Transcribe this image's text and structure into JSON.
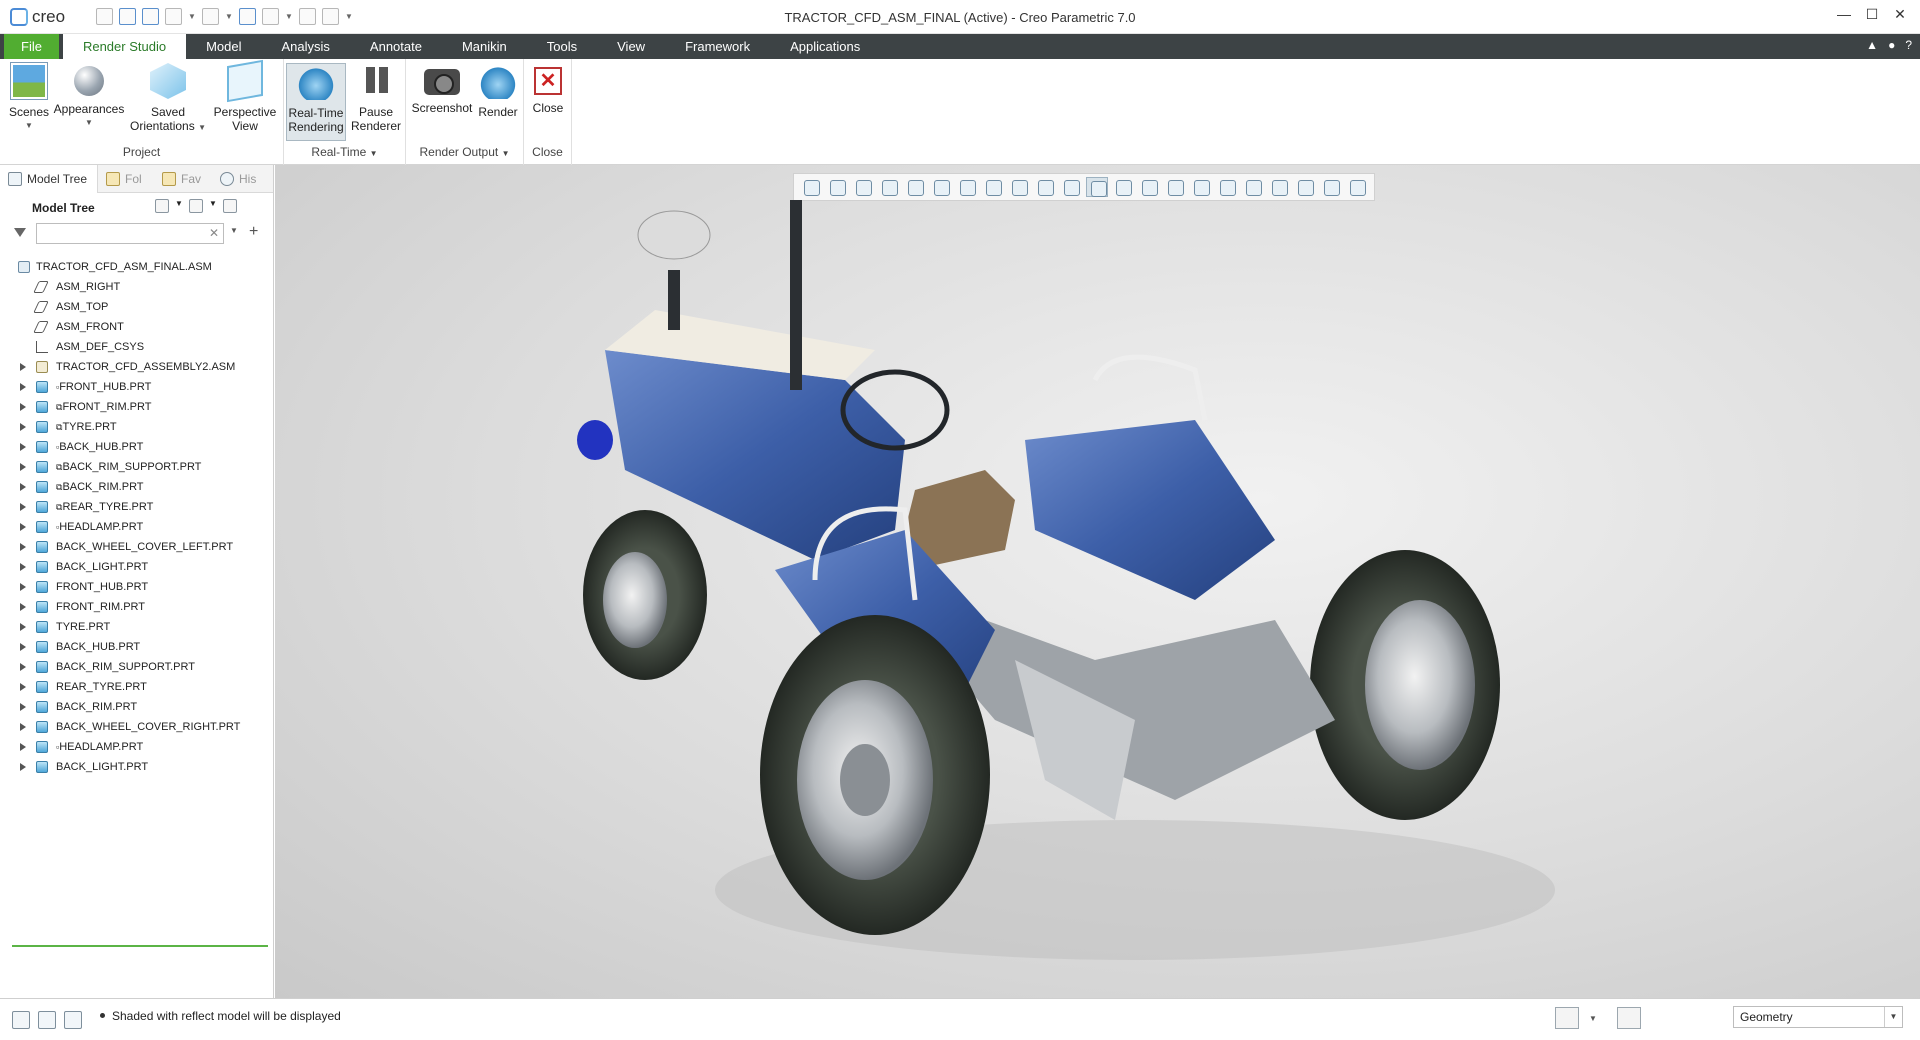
{
  "app": {
    "logo_text": "creo",
    "title": "TRACTOR_CFD_ASM_FINAL (Active) - Creo Parametric 7.0"
  },
  "window_controls": [
    "—",
    "☐",
    "✕"
  ],
  "ribbon_tabs": [
    {
      "label": "File",
      "name": "tab-file"
    },
    {
      "label": "Render Studio",
      "name": "tab-render-studio"
    },
    {
      "label": "Model",
      "name": "tab-model"
    },
    {
      "label": "Analysis",
      "name": "tab-analysis"
    },
    {
      "label": "Annotate",
      "name": "tab-annotate"
    },
    {
      "label": "Manikin",
      "name": "tab-manikin"
    },
    {
      "label": "Tools",
      "name": "tab-tools"
    },
    {
      "label": "View",
      "name": "tab-view"
    },
    {
      "label": "Framework",
      "name": "tab-framework"
    },
    {
      "label": "Applications",
      "name": "tab-applications"
    }
  ],
  "active_tab": "Render Studio",
  "ribbon": {
    "project": {
      "label": "Project",
      "scenes": "Scenes",
      "appearances": "Appearances",
      "saved_orientations": "Saved Orientations",
      "saved_orientations_l1": "Saved",
      "saved_orientations_l2": "Orientations",
      "perspective_l1": "Perspective",
      "perspective_l2": "View"
    },
    "realtime": {
      "label": "Real-Time",
      "rendering_l1": "Real-Time",
      "rendering_l2": "Rendering",
      "pause_l1": "Pause",
      "pause_l2": "Renderer"
    },
    "render_output": {
      "label": "Render Output",
      "screenshot": "Screenshot",
      "render": "Render"
    },
    "close": {
      "label": "Close",
      "close": "Close"
    }
  },
  "left_pane": {
    "tabs": [
      "Model Tree",
      "Fol",
      "Fav",
      "His"
    ],
    "tree_title": "Model Tree",
    "search_placeholder": "",
    "root": "TRACTOR_CFD_ASM_FINAL.ASM",
    "items": [
      {
        "label": "ASM_RIGHT",
        "type": "plane",
        "expand": false
      },
      {
        "label": "ASM_TOP",
        "type": "plane",
        "expand": false
      },
      {
        "label": "ASM_FRONT",
        "type": "plane",
        "expand": false
      },
      {
        "label": "ASM_DEF_CSYS",
        "type": "csys",
        "expand": false
      },
      {
        "label": "TRACTOR_CFD_ASSEMBLY2.ASM",
        "type": "asm",
        "expand": true
      },
      {
        "label": "FRONT_HUB.PRT",
        "type": "part",
        "expand": true,
        "tag": "▫"
      },
      {
        "label": "FRONT_RIM.PRT",
        "type": "part",
        "expand": true,
        "tag": "⧉"
      },
      {
        "label": "TYRE.PRT",
        "type": "part",
        "expand": true,
        "tag": "⧉"
      },
      {
        "label": "BACK_HUB.PRT",
        "type": "part",
        "expand": true,
        "tag": "▫"
      },
      {
        "label": "BACK_RIM_SUPPORT.PRT",
        "type": "part",
        "expand": true,
        "tag": "⧉"
      },
      {
        "label": "BACK_RIM.PRT",
        "type": "part",
        "expand": true,
        "tag": "⧉"
      },
      {
        "label": "REAR_TYRE.PRT",
        "type": "part",
        "expand": true,
        "tag": "⧉"
      },
      {
        "label": "HEADLAMP.PRT",
        "type": "part",
        "expand": true,
        "tag": "▫"
      },
      {
        "label": "BACK_WHEEL_COVER_LEFT.PRT",
        "type": "part",
        "expand": true
      },
      {
        "label": "BACK_LIGHT.PRT",
        "type": "part",
        "expand": true
      },
      {
        "label": "FRONT_HUB.PRT",
        "type": "part",
        "expand": true
      },
      {
        "label": "FRONT_RIM.PRT",
        "type": "part",
        "expand": true
      },
      {
        "label": "TYRE.PRT",
        "type": "part",
        "expand": true
      },
      {
        "label": "BACK_HUB.PRT",
        "type": "part",
        "expand": true
      },
      {
        "label": "BACK_RIM_SUPPORT.PRT",
        "type": "part",
        "expand": true
      },
      {
        "label": "REAR_TYRE.PRT",
        "type": "part",
        "expand": true
      },
      {
        "label": "BACK_RIM.PRT",
        "type": "part",
        "expand": true
      },
      {
        "label": "BACK_WHEEL_COVER_RIGHT.PRT",
        "type": "part",
        "expand": true
      },
      {
        "label": "HEADLAMP.PRT",
        "type": "part",
        "expand": true,
        "tag": "▫"
      },
      {
        "label": "BACK_LIGHT.PRT",
        "type": "part",
        "expand": true
      }
    ]
  },
  "graphics_toolbar": [
    "refit-icon",
    "zoom-in-icon",
    "zoom-out-icon",
    "repaint-icon",
    "spin-center-icon",
    "saved-views-icon",
    "display-style-icon",
    "named-view-icon",
    "section-icon",
    "perspective-icon",
    "appearance-icon",
    "realtime-render-icon",
    "datum-display-icon",
    "plane-icon",
    "axis-icon",
    "point-icon",
    "csys-icon",
    "annotation-icon",
    "spin-icon",
    "triangle-icon",
    "pause-icon",
    "hide-toolbar-icon"
  ],
  "statusbar": {
    "message": "Shaded with reflect model will be displayed",
    "filter_value": "Geometry"
  },
  "colors": {
    "file_tab": "#51ad31",
    "tab_bar": "#3d4345",
    "active_tab_text": "#2b7b29",
    "body_blue": "#3d5fa8"
  }
}
